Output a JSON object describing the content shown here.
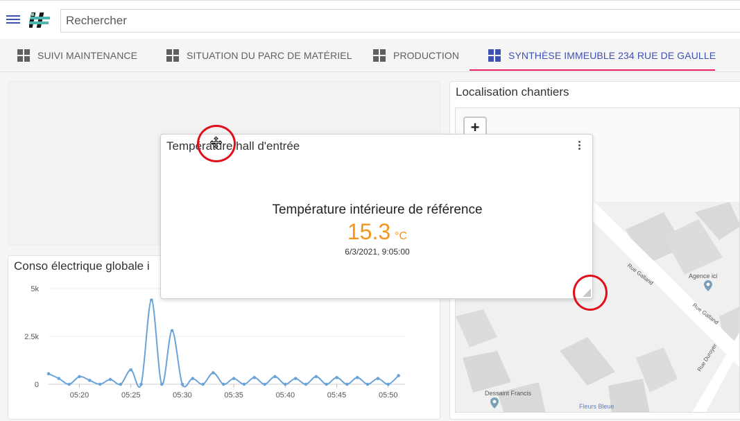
{
  "search": {
    "placeholder": "Rechercher"
  },
  "tabs": [
    {
      "label": "SUIVI MAINTENANCE",
      "active": false
    },
    {
      "label": "SITUATION DU PARC DE MATÉRIEL",
      "active": false
    },
    {
      "label": "PRODUCTION",
      "active": false
    },
    {
      "label": "SYNTHÈSE IMMEUBLE 234 RUE DE GAULLE",
      "active": true
    }
  ],
  "colors": {
    "accent": "#3f51b5",
    "tab_indicator": "#e91e63",
    "value": "#f7941d",
    "annotation": "#e0101a",
    "line": "#6aa3d8"
  },
  "map_card": {
    "title": "Localisation chantiers",
    "zoom_in_label": "+",
    "streets": [
      "Rue Galland",
      "Rue Galland",
      "Rue Duroyer"
    ],
    "pois": [
      "Agence ici",
      "Dessaint Francis",
      "Fleurs Bleue"
    ]
  },
  "conso_card": {
    "title": "Conso électrique globale i"
  },
  "temp_widget": {
    "title": "Température hall d'entrée",
    "label": "Température intérieure de référence",
    "value": "15.3",
    "unit": "°C",
    "timestamp": "6/3/2021, 9:05:00"
  },
  "icons": [
    "menu-icon",
    "app-logo-icon",
    "dashboard-icon",
    "more-vert-icon",
    "move-cursor-icon",
    "resize-handle-icon",
    "map-pin-icon"
  ],
  "chart_data": {
    "type": "line",
    "title": "Conso électrique globale i",
    "y_ticks": [
      "5k",
      "2.5k",
      "0"
    ],
    "x_ticks": [
      "05:20",
      "05:25",
      "05:30",
      "05:35",
      "05:40",
      "05:45",
      "05:50"
    ],
    "ylim": [
      0,
      5000
    ],
    "xlim": [
      17,
      51.5
    ],
    "grid": true,
    "series": [
      {
        "x": [
          17,
          18,
          19,
          20,
          21,
          22,
          23,
          24,
          25,
          26,
          27,
          28,
          29,
          30,
          31,
          32,
          33,
          34,
          35,
          36,
          37,
          38,
          39,
          40,
          41,
          42,
          43,
          44,
          45,
          46,
          47,
          48,
          49,
          50,
          51
        ],
        "values": [
          550,
          300,
          0,
          400,
          200,
          0,
          250,
          0,
          750,
          0,
          4400,
          0,
          2800,
          0,
          300,
          0,
          600,
          0,
          300,
          0,
          350,
          0,
          400,
          0,
          300,
          0,
          400,
          0,
          350,
          0,
          350,
          0,
          300,
          0,
          450
        ]
      }
    ]
  }
}
